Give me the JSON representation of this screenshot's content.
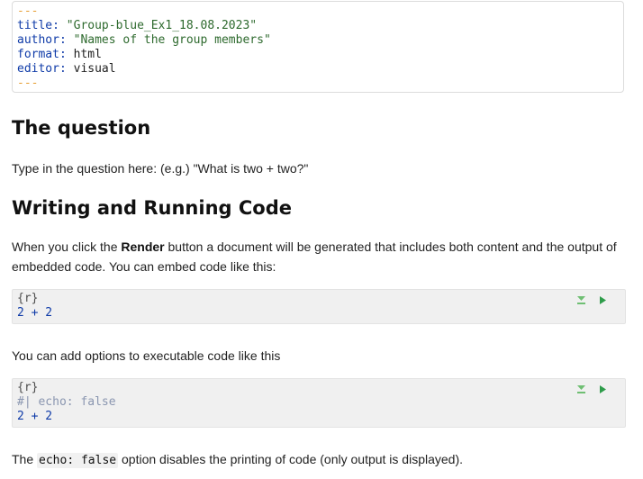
{
  "yaml": {
    "open_dashes": "---",
    "close_dashes": "---",
    "fields": [
      {
        "key": "title",
        "value": "\"Group-blue_Ex1_18.08.2023\"",
        "kind": "str"
      },
      {
        "key": "author",
        "value": "\"Names of the group members\"",
        "kind": "str"
      },
      {
        "key": "format",
        "value": "html",
        "kind": "plain"
      },
      {
        "key": "editor",
        "value": "visual",
        "kind": "plain"
      }
    ]
  },
  "section_question": {
    "heading": "The question",
    "text": "Type in the question here: (e.g.) \"What is two + two?\""
  },
  "section_code": {
    "heading": "Writing and Running Code",
    "intro_before": "When you click the ",
    "intro_bold": "Render",
    "intro_after": " button a document will be generated that includes both content and the output of embedded code. You can embed code like this:",
    "options_text": "You can add options to executable code like this",
    "footer_before": "The ",
    "footer_code": "echo: false",
    "footer_after": " option disables the printing of code (only output is displayed)."
  },
  "chunks": [
    {
      "header": "{r}",
      "lines": [
        {
          "text": "2 + 2",
          "kind": "code"
        }
      ]
    },
    {
      "header": "{r}",
      "lines": [
        {
          "text": "#| echo: false",
          "kind": "comment"
        },
        {
          "text": "2 + 2",
          "kind": "code"
        }
      ]
    }
  ],
  "colors": {
    "run_above": "#6fbf73",
    "run_chunk": "#2e9c4a"
  },
  "icons": {
    "run_above": "run-above-icon",
    "run_chunk": "run-chunk-icon"
  }
}
